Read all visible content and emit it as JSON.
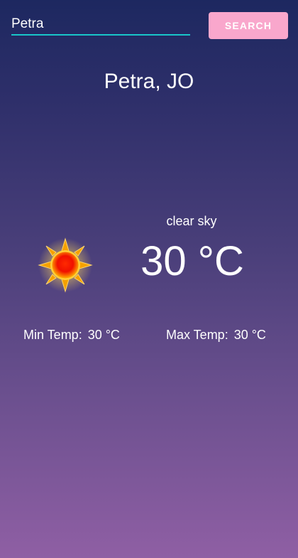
{
  "search": {
    "value": "Petra",
    "button_label": "SEARCH"
  },
  "location": {
    "city": "Petra, JO"
  },
  "weather": {
    "description": "clear sky",
    "temperature": "30 °C",
    "icon": "sun-icon",
    "min_label": "Min Temp:",
    "min_value": "30 °C",
    "max_label": "Max Temp:",
    "max_value": "30 °C"
  },
  "colors": {
    "background_top": "#1d2860",
    "background_bottom": "#8f5fa4",
    "input_underline": "#19c6c9",
    "button_background": "#f9a7cc",
    "text": "#ffffff"
  }
}
